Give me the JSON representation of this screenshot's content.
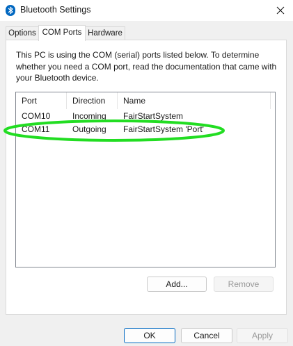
{
  "window": {
    "title": "Bluetooth Settings",
    "icon": "bluetooth-icon",
    "close_icon": "close-icon"
  },
  "tabs": [
    {
      "label": "Options",
      "active": false
    },
    {
      "label": "COM Ports",
      "active": true
    },
    {
      "label": "Hardware",
      "active": false
    }
  ],
  "panel": {
    "description": "This PC is using the COM (serial) ports listed below. To determine whether you need a COM port, read the documentation that came with your Bluetooth device.",
    "columns": [
      "Port",
      "Direction",
      "Name"
    ],
    "rows": [
      {
        "port": "COM10",
        "direction": "Incoming",
        "name": "FairStartSystem"
      },
      {
        "port": "COM11",
        "direction": "Outgoing",
        "name": "FairStartSystem 'Port'"
      }
    ],
    "add_label": "Add...",
    "remove_label": "Remove"
  },
  "footer": {
    "ok_label": "OK",
    "cancel_label": "Cancel",
    "apply_label": "Apply"
  },
  "colors": {
    "accent": "#0067c0",
    "annotation": "#22dd22"
  }
}
